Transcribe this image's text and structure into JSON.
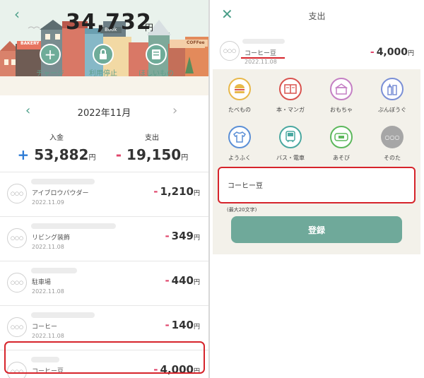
{
  "left": {
    "balance": "34,732",
    "balance_unit": "円",
    "hero_buttons": [
      {
        "label": "チャージ",
        "icon": "plus-icon"
      },
      {
        "label": "利用停止",
        "icon": "lock-icon"
      },
      {
        "label": "ほしいもの",
        "icon": "wishlist-icon"
      }
    ],
    "town_signs": [
      "BAKERY",
      "Book",
      "COFFee"
    ],
    "month": "2022年11月",
    "income": {
      "label": "入金",
      "sign": "+",
      "value": "53,882",
      "unit": "円"
    },
    "expense": {
      "label": "支出",
      "sign": "-",
      "value": "19,150",
      "unit": "円"
    },
    "transactions": [
      {
        "name": "アイブロウパウダー",
        "date": "2022.11.09",
        "amount": "1,210",
        "unit": "円",
        "avatar": "○○○"
      },
      {
        "name": "リビング装飾",
        "date": "2022.11.08",
        "amount": "349",
        "unit": "円",
        "avatar": "○○○"
      },
      {
        "name": "駐車場",
        "date": "2022.11.08",
        "amount": "440",
        "unit": "円",
        "avatar": "○○○"
      },
      {
        "name": "コーヒー",
        "date": "2022.11.08",
        "amount": "140",
        "unit": "円",
        "avatar": "○○○"
      },
      {
        "name": "コーヒー豆",
        "date": "",
        "amount": "4,000",
        "unit": "円",
        "avatar": "○○○"
      }
    ]
  },
  "right": {
    "title": "支出",
    "tx": {
      "name": "コーヒー豆",
      "date": "2022.11.08",
      "amount": "4,000",
      "unit": "円",
      "avatar": "○○○"
    },
    "categories": [
      {
        "label": "たべもの",
        "icon": "food-icon",
        "color": "#e8b84a"
      },
      {
        "label": "本・マンガ",
        "icon": "book-icon",
        "color": "#d9534f"
      },
      {
        "label": "おもちゃ",
        "icon": "toy-icon",
        "color": "#c47fc4"
      },
      {
        "label": "ぶんぼうぐ",
        "icon": "stationery-icon",
        "color": "#7a8fd6"
      },
      {
        "label": "ようふく",
        "icon": "clothes-icon",
        "color": "#5b8fd6"
      },
      {
        "label": "バス・電車",
        "icon": "train-icon",
        "color": "#4aa8a0"
      },
      {
        "label": "あそび",
        "icon": "game-icon",
        "color": "#5cb85c"
      },
      {
        "label": "そのた",
        "icon": "other-icon",
        "color": "#a6a6a6"
      }
    ],
    "memo_value": "コーヒー豆",
    "memo_note": "(最大20文字)",
    "submit_label": "登録"
  },
  "colors": {
    "accent": "#6fa99a",
    "minus": "#e0456b",
    "plus": "#2f7cd6",
    "highlight": "#d6242b"
  }
}
